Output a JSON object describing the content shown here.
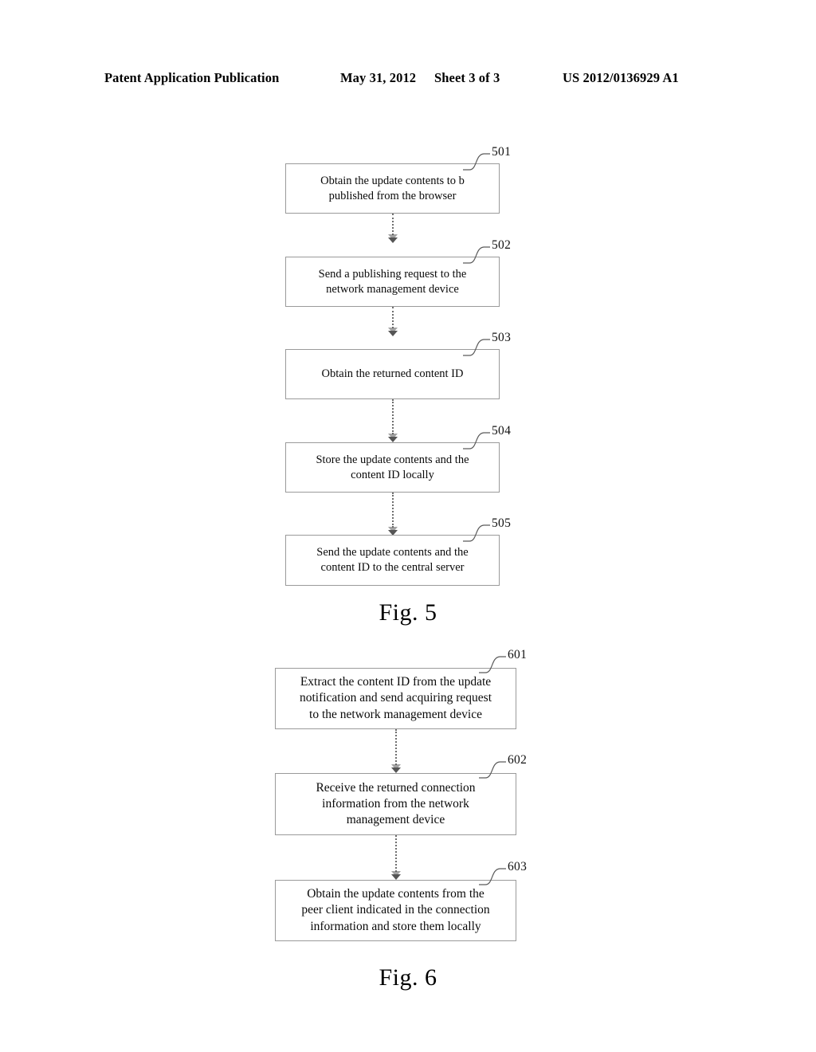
{
  "header": {
    "publication": "Patent Application Publication",
    "date": "May 31, 2012",
    "sheet": "Sheet 3 of 3",
    "patent_number": "US 2012/0136929 A1"
  },
  "figures": [
    {
      "id": "figure-5",
      "caption": "Fig. 5",
      "steps": [
        {
          "ref": "501",
          "text": "Obtain the update contents to b\npublished from the browser"
        },
        {
          "ref": "502",
          "text": "Send a publishing request  to the\nnetwork management device"
        },
        {
          "ref": "503",
          "text": "Obtain the returned content ID"
        },
        {
          "ref": "504",
          "text": "Store the update contents and the\ncontent ID locally"
        },
        {
          "ref": "505",
          "text": "Send the update contents and the\ncontent ID to the central server"
        }
      ]
    },
    {
      "id": "figure-6",
      "caption": "Fig. 6",
      "steps": [
        {
          "ref": "601",
          "text": "Extract the content ID from the update\nnotification and send acquiring request\nto the network management device"
        },
        {
          "ref": "602",
          "text": "Receive the returned connection\ninformation from the network\nmanagement device"
        },
        {
          "ref": "603",
          "text": "Obtain the update contents from the\npeer client indicated in the connection\ninformation and store them locally"
        }
      ]
    }
  ],
  "colors": {
    "box_border": "#9a9a9a",
    "connector": "#6e6e6e",
    "text": "#0a0a0a",
    "background": "#ffffff"
  }
}
